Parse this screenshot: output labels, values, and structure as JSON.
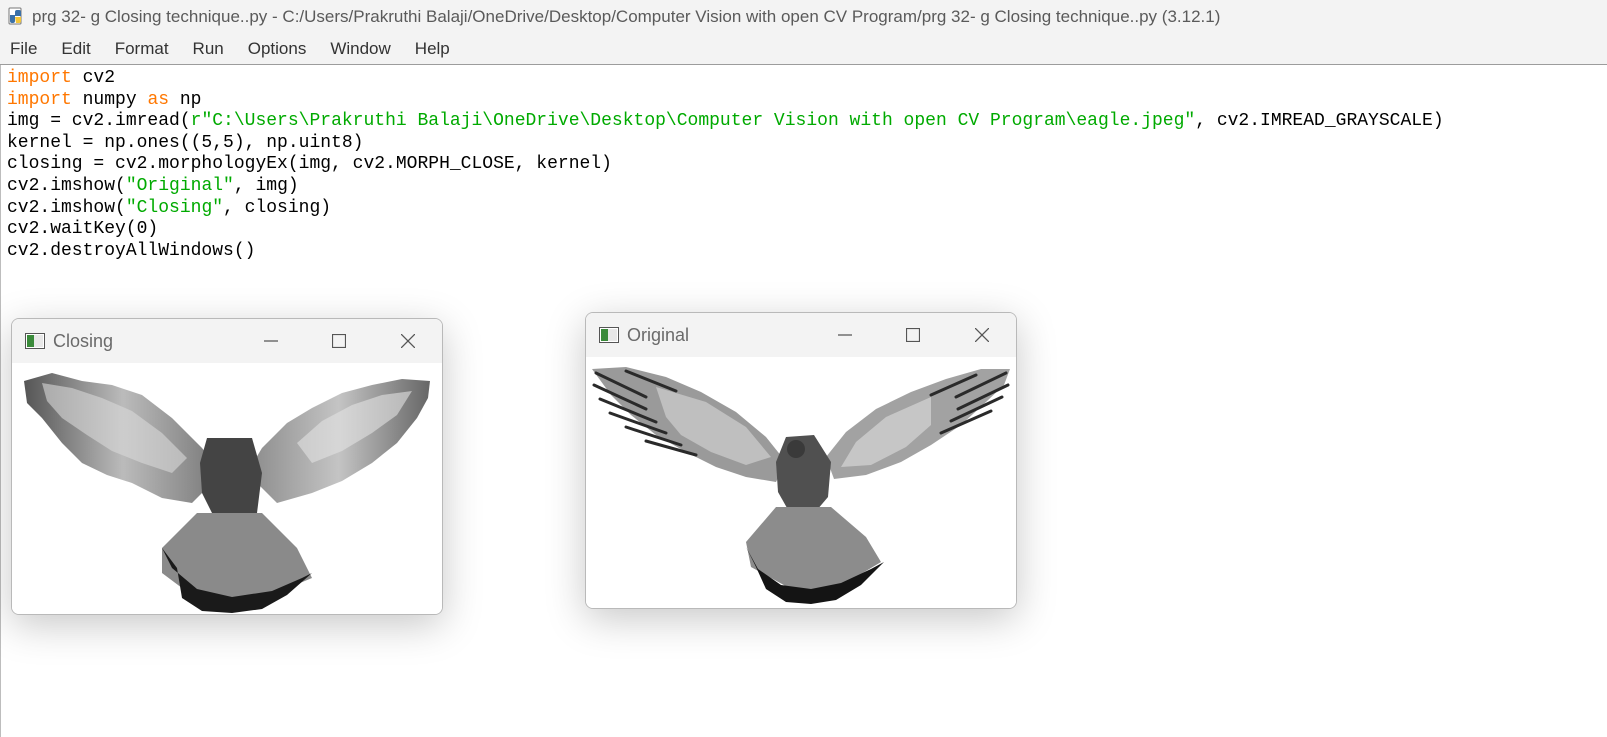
{
  "window": {
    "title": "prg 32- g Closing technique..py - C:/Users/Prakruthi Balaji/OneDrive/Desktop/Computer Vision with open CV Program/prg 32- g Closing technique..py (3.12.1)"
  },
  "menu": {
    "items": [
      {
        "label": "File"
      },
      {
        "label": "Edit"
      },
      {
        "label": "Format"
      },
      {
        "label": "Run"
      },
      {
        "label": "Options"
      },
      {
        "label": "Window"
      },
      {
        "label": "Help"
      }
    ]
  },
  "code": {
    "line1": {
      "kw": "import",
      "rest": " cv2"
    },
    "line2": {
      "kw1": "import",
      "mid": " numpy ",
      "kw2": "as",
      "rest": " np"
    },
    "line3": {
      "pre": "img = cv2.imread(",
      "str": "r\"C:\\Users\\Prakruthi Balaji\\OneDrive\\Desktop\\Computer Vision with open CV Program\\eagle.jpeg\"",
      "post": ", cv2.IMREAD_GRAYSCALE)"
    },
    "line4": "kernel = np.ones((5,5), np.uint8)",
    "line5": "closing = cv2.morphologyEx(img, cv2.MORPH_CLOSE, kernel)",
    "line6": {
      "pre": "cv2.imshow(",
      "str": "\"Original\"",
      "post": ", img)"
    },
    "line7": {
      "pre": "cv2.imshow(",
      "str": "\"Closing\"",
      "post": ", closing)"
    },
    "line8": "cv2.waitKey(0)",
    "line9": "cv2.destroyAllWindows()"
  },
  "windows": {
    "closing": {
      "title": "Closing",
      "image": "eagle-grayscale-closing"
    },
    "original": {
      "title": "Original",
      "image": "eagle-grayscale"
    }
  },
  "colors": {
    "keyword": "#ff7700",
    "string": "#00aa00",
    "chrome": "#f3f3f3"
  }
}
